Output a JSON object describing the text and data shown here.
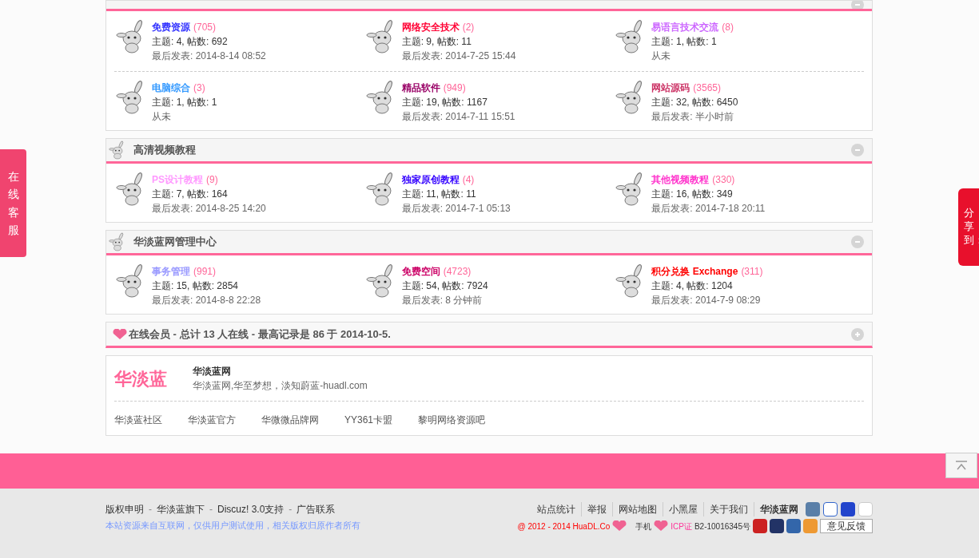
{
  "side_service": {
    "label": "在线客服"
  },
  "side_share": {
    "label": "分享到："
  },
  "sections": [
    {
      "expanded": true,
      "rows": [
        [
          {
            "name": "免费资源",
            "color": "#3333ff",
            "count": "(705)",
            "stats": "主题: 4, 帖数: 692",
            "last": "最后发表: 2014-8-14 08:52"
          },
          {
            "name": "网络安全技术",
            "color": "#ff0033",
            "count": "(2)",
            "stats": "主题: 9, 帖数: 11",
            "last": "最后发表: 2014-7-25 15:44"
          },
          {
            "name": "易语言技术交流",
            "color": "#cc66ff",
            "count": "(8)",
            "stats": "主题: 1, 帖数: 1",
            "last": "从未"
          }
        ],
        [
          {
            "name": "电脑综合",
            "color": "#3399ff",
            "count": "(3)",
            "stats": "主题: 1, 帖数: 1",
            "last": "从未"
          },
          {
            "name": "精品软件",
            "color": "#990066",
            "count": "(949)",
            "stats": "主题: 19, 帖数: 1167",
            "last": "最后发表: 2014-7-11 15:51"
          },
          {
            "name": "网站源码",
            "color": "#cc3366",
            "count": "(3565)",
            "stats": "主题: 32, 帖数: 6450",
            "last": "最后发表: 半小时前"
          }
        ]
      ]
    },
    {
      "title": "高清视频教程",
      "expanded": true,
      "rows": [
        [
          {
            "name": "PS设计教程",
            "color": "#ff99ff",
            "count": "(9)",
            "stats": "主题: 7, 帖数: 164",
            "last": "最后发表: 2014-8-25 14:20"
          },
          {
            "name": "独家原创教程",
            "color": "#3300ff",
            "count": "(4)",
            "stats": "主题: 11, 帖数: 11",
            "last": "最后发表: 2014-7-1 05:13"
          },
          {
            "name": "其他视频教程",
            "color": "#ff33cc",
            "count": "(330)",
            "stats": "主题: 16, 帖数: 349",
            "last": "最后发表: 2014-7-18 20:11"
          }
        ]
      ]
    },
    {
      "title": "华淡蓝网管理中心",
      "expanded": true,
      "rows": [
        [
          {
            "name": "事务管理",
            "color": "#9999ff",
            "count": "(991)",
            "stats": "主题: 15, 帖数: 2854",
            "last": "最后发表: 2014-8-8 22:28"
          },
          {
            "name": "免费空间",
            "color": "#cc0066",
            "count": "(4723)",
            "stats": "主题: 54, 帖数: 7924",
            "last": "最后发表: 8 分钟前"
          },
          {
            "name": "积分兑换 Exchange",
            "color": "#ff0000",
            "count": "(311)",
            "stats": "主题: 4, 帖数: 1204",
            "last": "最后发表: 2014-7-9 08:29"
          }
        ]
      ]
    }
  ],
  "online": {
    "title": "在线会员 - 总计 13 人在线 - 最高记录是 86 于 2014-10-5.",
    "expanded": false
  },
  "links_box": {
    "logo": "华淡蓝",
    "site_name": "华淡蓝网",
    "description": "华淡蓝网,华至梦想，淡知蔚蓝-huadl.com",
    "links": [
      "华淡蓝社区",
      "华淡蓝官方",
      "华微微品牌网",
      "YY361卡盟",
      "黎明网络资源吧"
    ]
  },
  "footer": {
    "left_links": [
      "版权申明",
      "华淡蓝旗下",
      "Discuz! 3.0支持",
      "广告联系"
    ],
    "separator": "-",
    "note": "本站资源来自互联网，仅供用户测试使用，相关版权归原作者所有",
    "right_links": [
      "站点统计",
      "举报",
      "网站地图",
      "小黑屋",
      "关于我们",
      "华淡蓝网"
    ],
    "copyright": "@ 2012 - 2014 HuaDL.Co",
    "mobile": "手机",
    "icp": "ICP证",
    "icp_number": "B2-10016345号",
    "feedback": "意见反馈"
  }
}
